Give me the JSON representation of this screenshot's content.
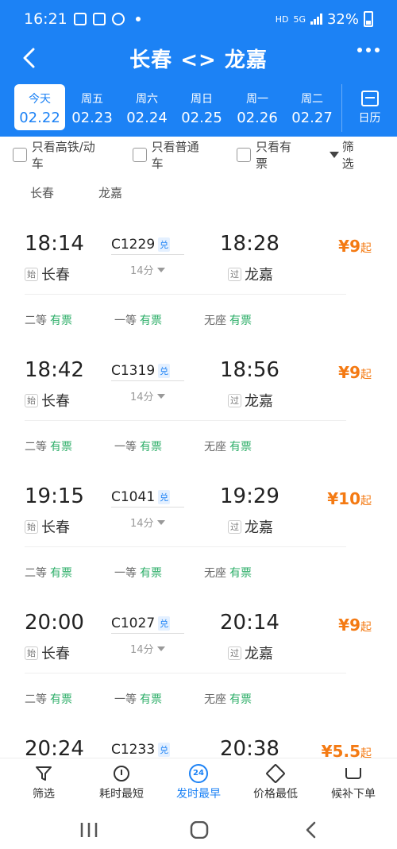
{
  "status": {
    "time": "16:21",
    "network": "HD",
    "net5g": "5G",
    "battery": "32%"
  },
  "nav": {
    "title": "长春 <> 龙嘉"
  },
  "dates": [
    {
      "weekday": "今天",
      "date": "02.22",
      "active": true
    },
    {
      "weekday": "周五",
      "date": "02.23"
    },
    {
      "weekday": "周六",
      "date": "02.24"
    },
    {
      "weekday": "周日",
      "date": "02.25"
    },
    {
      "weekday": "周一",
      "date": "02.26"
    },
    {
      "weekday": "周二",
      "date": "02.27"
    }
  ],
  "calendar_label": "日历",
  "filters": {
    "high_speed": "只看高铁/动车",
    "normal": "只看普通车",
    "available": "只看有票",
    "filter": "筛选"
  },
  "stations": {
    "from": "长春",
    "to": "龙嘉"
  },
  "trains": [
    {
      "dep": "18:14",
      "no": "C1229",
      "dui": "兑",
      "duration": "14分",
      "arr": "18:28",
      "from_tag": "始",
      "from": "长春",
      "to_tag": "过",
      "to": "龙嘉",
      "price": "¥9",
      "qi": "起",
      "s1": "二等",
      "s2": "一等",
      "s3": "无座",
      "avail": "有票"
    },
    {
      "dep": "18:42",
      "no": "C1319",
      "dui": "兑",
      "duration": "14分",
      "arr": "18:56",
      "from_tag": "始",
      "from": "长春",
      "to_tag": "过",
      "to": "龙嘉",
      "price": "¥9",
      "qi": "起",
      "s1": "二等",
      "s2": "一等",
      "s3": "无座",
      "avail": "有票"
    },
    {
      "dep": "19:15",
      "no": "C1041",
      "dui": "兑",
      "duration": "14分",
      "arr": "19:29",
      "from_tag": "始",
      "from": "长春",
      "to_tag": "过",
      "to": "龙嘉",
      "price": "¥10",
      "qi": "起",
      "s1": "二等",
      "s2": "一等",
      "s3": "无座",
      "avail": "有票"
    },
    {
      "dep": "20:00",
      "no": "C1027",
      "dui": "兑",
      "duration": "14分",
      "arr": "20:14",
      "from_tag": "始",
      "from": "长春",
      "to_tag": "过",
      "to": "龙嘉",
      "price": "¥9",
      "qi": "起",
      "s1": "二等",
      "s2": "一等",
      "s3": "无座",
      "avail": "有票"
    },
    {
      "dep": "20:24",
      "no": "C1233",
      "dui": "兑",
      "arr": "20:38",
      "price": "¥5.5",
      "qi": "起"
    }
  ],
  "tabs": {
    "filter": "筛选",
    "shortest": "耗时最短",
    "earliest": "发时最早",
    "earliest_badge": "24",
    "cheapest": "价格最低",
    "waitlist": "候补下单"
  },
  "colors": {
    "primary": "#1c82f5",
    "price": "#f47a13",
    "available": "#2dae68"
  }
}
